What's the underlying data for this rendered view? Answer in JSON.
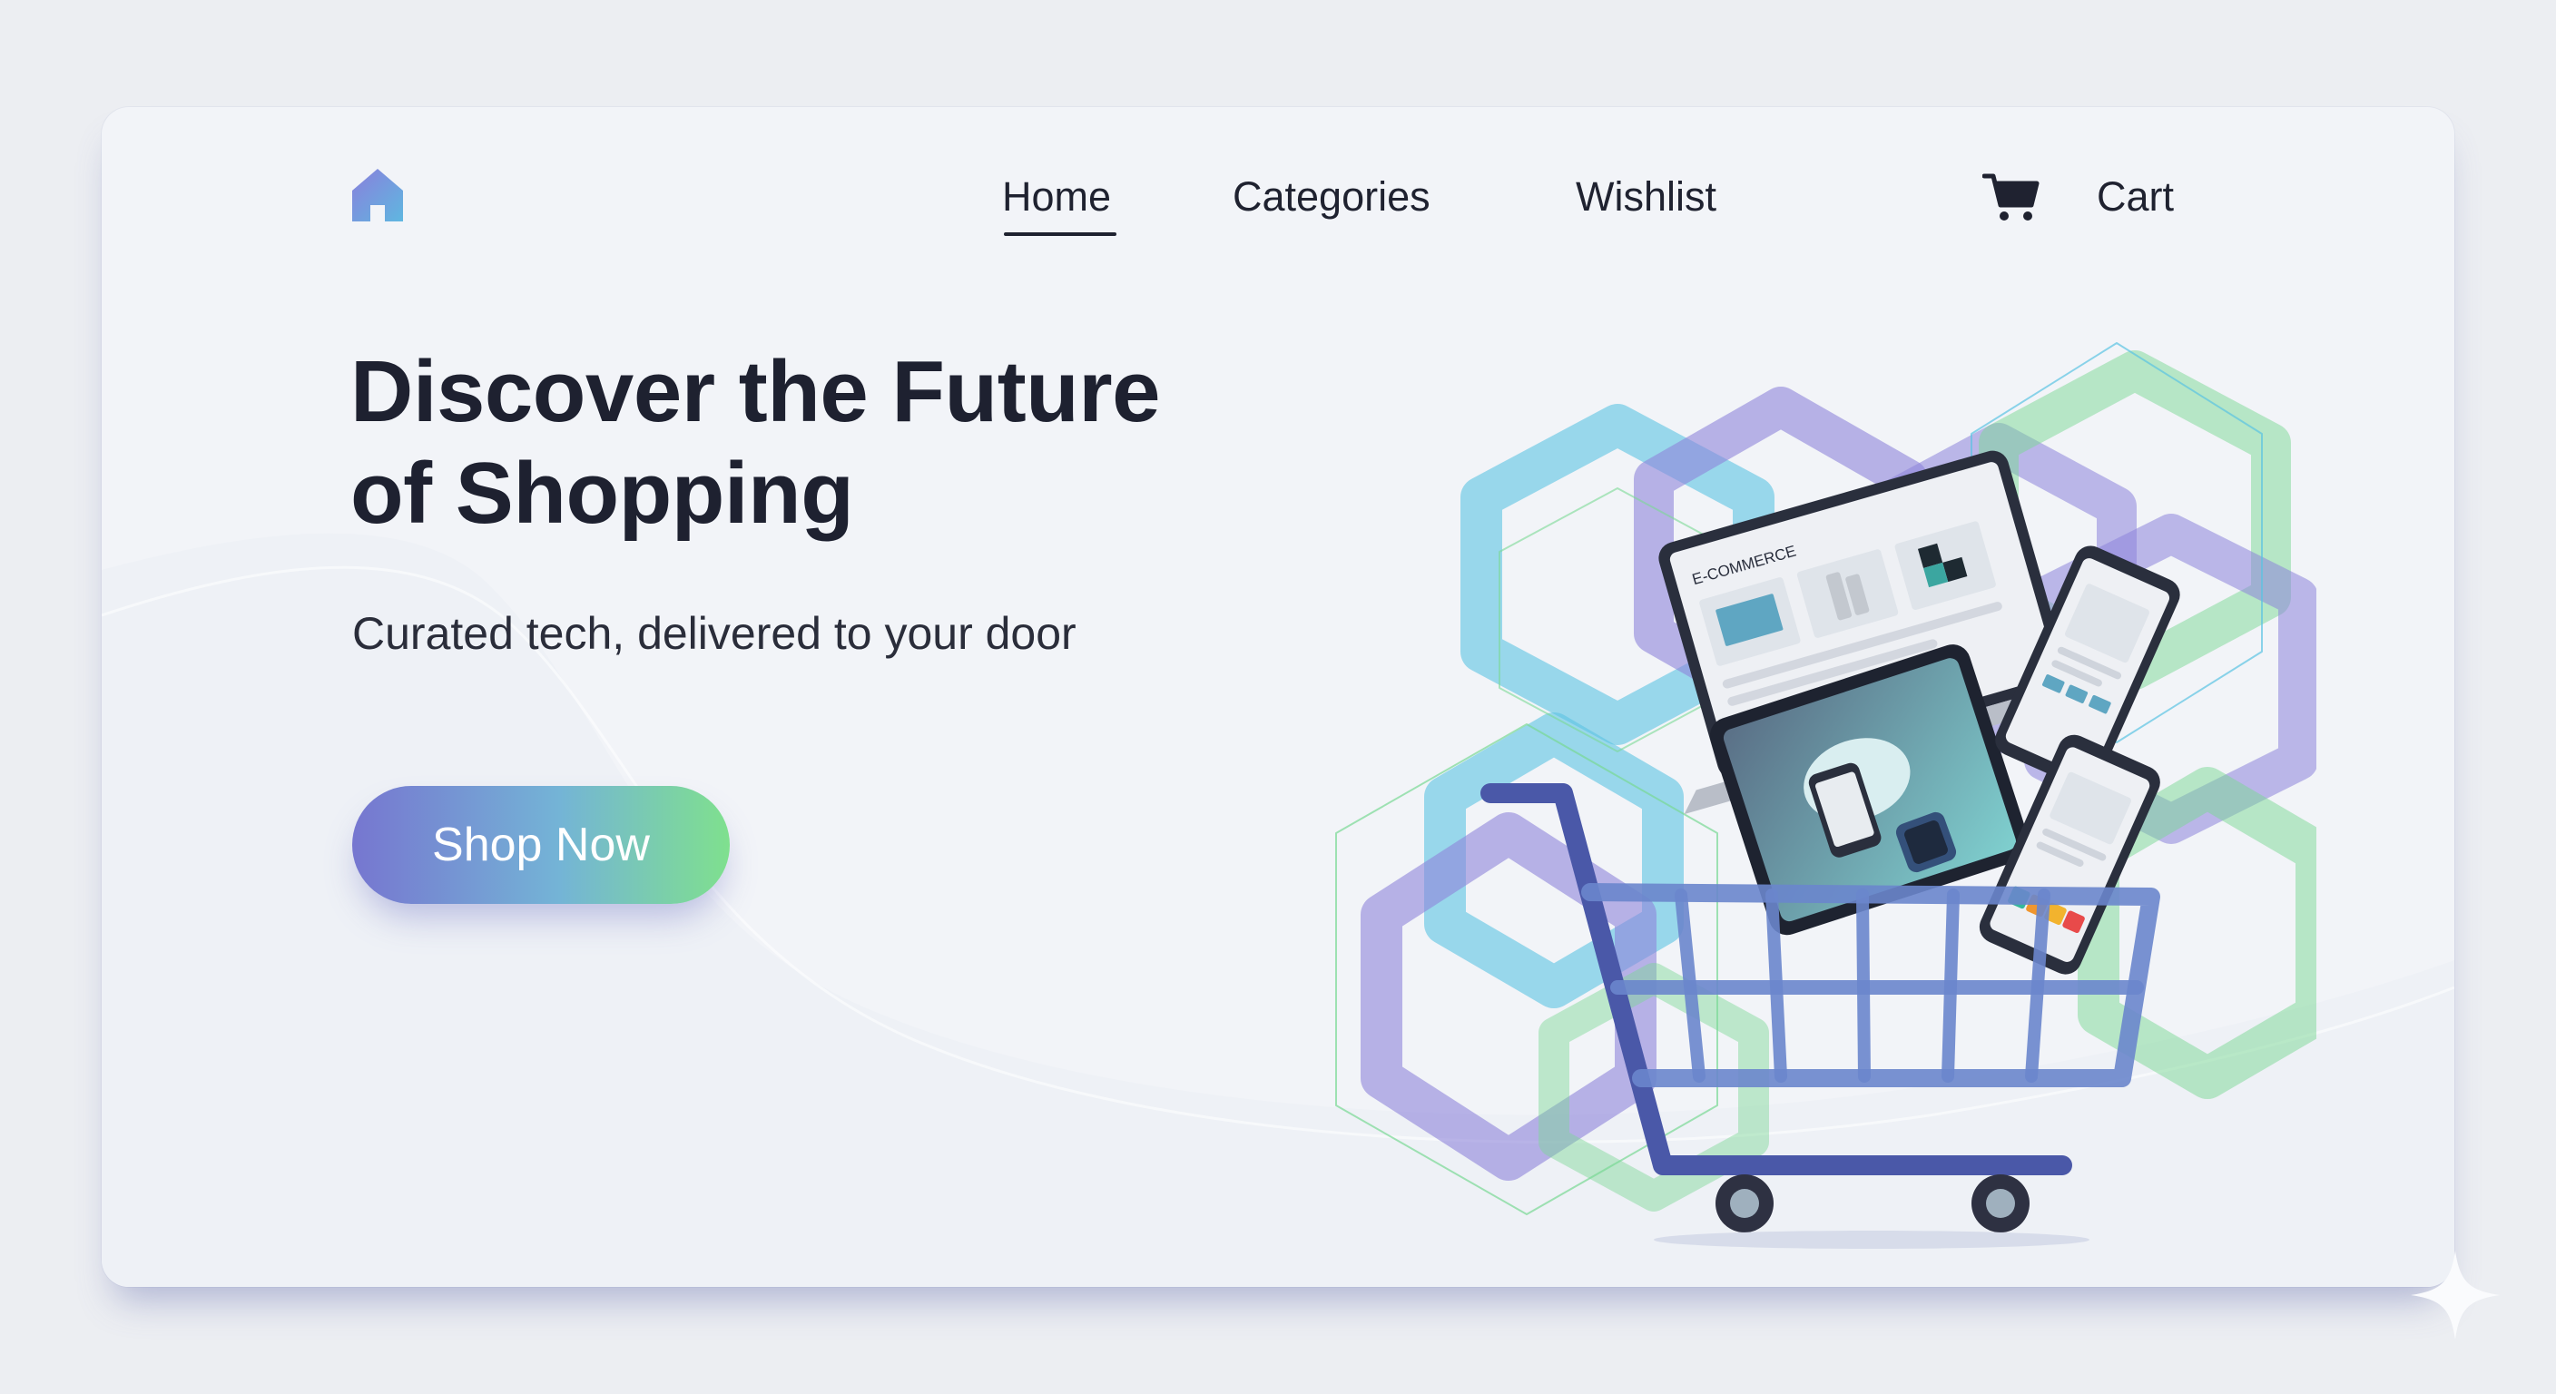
{
  "nav": {
    "items": [
      {
        "label": "Home",
        "active": true
      },
      {
        "label": "Categories",
        "active": false
      },
      {
        "label": "Wishlist",
        "active": false
      }
    ],
    "cart_label": "Cart",
    "logo_icon": "home-icon",
    "cart_icon": "shopping-cart-icon"
  },
  "hero": {
    "title_line1": "Discover the Future",
    "title_line2": "of Shopping",
    "subtitle": "Curated tech, delivered to your door",
    "cta_label": "Shop Now"
  },
  "illustration": {
    "screen_label": "E-COMMERCE"
  },
  "colors": {
    "background": "#eceef2",
    "card": "#f2f4f8",
    "text": "#1e2130",
    "accent_purple": "#7676d0",
    "accent_blue": "#74b4d6",
    "accent_green": "#7fe08e",
    "cart": "#6a86cc"
  }
}
